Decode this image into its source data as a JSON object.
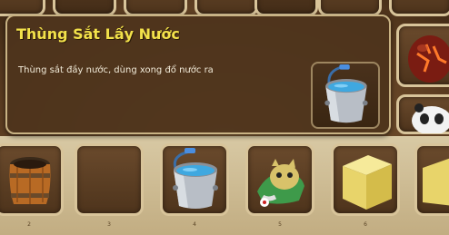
{
  "tooltip": {
    "title": "Thùng Sắt Lấy Nước",
    "description": "Thùng sắt đầy nước, dùng xong đổ nước ra",
    "icon": "water-bucket-icon"
  },
  "hotbar": {
    "slots": [
      {
        "number": "2",
        "item": "wooden-barrel-icon"
      },
      {
        "number": "3",
        "item": ""
      },
      {
        "number": "4",
        "item": "water-bucket-icon"
      },
      {
        "number": "5",
        "item": "green-creature-icon"
      },
      {
        "number": "6",
        "item": "sand-block-icon"
      }
    ]
  },
  "colors": {
    "title": "#f2e14a",
    "tooltip_bg": "#4e341c",
    "slot_border": "#d8c49a",
    "water": "#3fa8e0"
  }
}
